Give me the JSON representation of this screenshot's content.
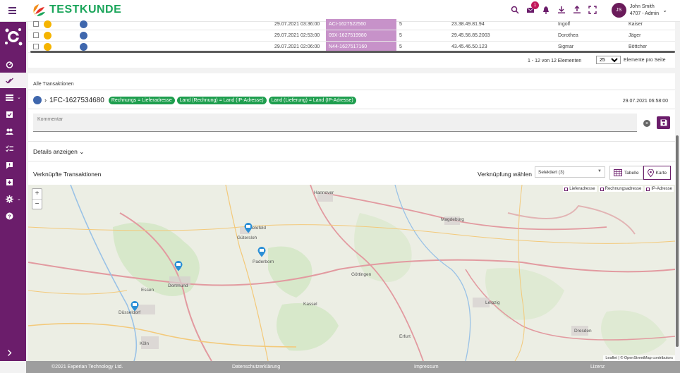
{
  "header": {
    "brand": "TESTKUNDE",
    "notifications_count": "1",
    "user": {
      "initials": "JS",
      "name": "John Smith",
      "sub": "4707 - Admin"
    }
  },
  "table": {
    "rows": [
      {
        "date": "29.07.2021 03:36:00",
        "id": "ACI-1627522560",
        "n": "5",
        "ip": "23.38.49.81.94",
        "first": "Ingolf",
        "last": "Kaiser"
      },
      {
        "date": "29.07.2021 02:53:00",
        "id": "09X-1627519980",
        "n": "5",
        "ip": "29.45.56.85.2003",
        "first": "Dorothea",
        "last": "Jäger"
      },
      {
        "date": "29.07.2021 02:06:00",
        "id": "N44-1627517160",
        "n": "5",
        "ip": "43.45.46.50.123",
        "first": "Sigmar",
        "last": "Böttcher"
      }
    ],
    "pager_text": "1 - 12 von 12 Elementen",
    "page_size": "25",
    "per_page_label": "Elemente pro Seite"
  },
  "detail": {
    "section_label": "Alle Transaktionen",
    "tx_id": "1FC-1627534680",
    "tags": [
      "Rechnungs = Lieferadresse",
      "Land (Rechnung) = Land (IP-Adresse)",
      "Land (Lieferung) = Land (IP-Adresse)"
    ],
    "tx_date": "29.07.2021 06:58:00",
    "comment_placeholder": "Kommentar",
    "details_toggle": "Details anzeigen",
    "linked_title": "Verknüpfte Transaktionen",
    "link_label": "Verknüpfung wählen",
    "link_value": "Selektiert (3)",
    "view_table": "Tabelle",
    "view_map": "Karte"
  },
  "map": {
    "legend": [
      "Lieferadresse",
      "Rechnungsadresse",
      "IP-Adresse"
    ],
    "zoom_in": "+",
    "zoom_out": "−",
    "attribution": "Leaflet | © OpenStreetMap contributors",
    "cities": [
      "Hannover",
      "Magdeburg",
      "Bielefeld",
      "Gütersloh",
      "Paderborn",
      "Dortmund",
      "Essen",
      "Düsseldorf",
      "Kassel",
      "Göttingen",
      "Leipzig",
      "Dresden",
      "Erfurt",
      "Köln"
    ]
  },
  "footer": {
    "copyright": "©2021 Experian Technology Ltd.",
    "privacy": "Datenschutzerklärung",
    "imprint": "Impressum",
    "license": "Lizenz"
  },
  "colors": {
    "brand_purple": "#6b1d6b",
    "tag_green": "#1e9e4e",
    "pill_purple": "#c792c9",
    "dot_yellow": "#f5b400",
    "dot_blue": "#3f67ad"
  }
}
